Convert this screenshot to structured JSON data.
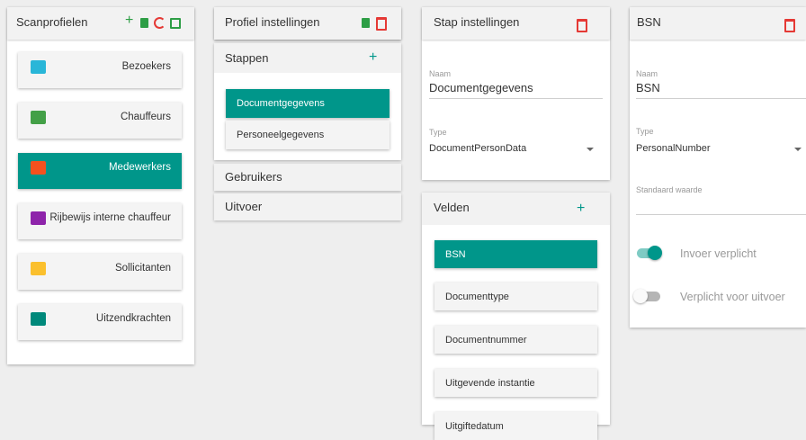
{
  "colors": {
    "accent": "#00968a",
    "green_icon": "#2e9e46",
    "red_icon": "#e53935"
  },
  "scanprofielen": {
    "title": "Scanprofielen",
    "actions": [
      "plus-icon",
      "file-icon",
      "refresh-icon",
      "save-icon"
    ],
    "items": [
      {
        "label": "Bezoekers",
        "icon": "walk-icon",
        "color": "#29b6d8"
      },
      {
        "label": "Chauffeurs",
        "icon": "truck-icon",
        "color": "#43a047"
      },
      {
        "label": "Medewerkers",
        "icon": "person-add-icon",
        "color": "#f4511e",
        "active": true
      },
      {
        "label": "Rijbewijs interne chauffeur",
        "icon": "bus-icon",
        "color": "#8e24aa"
      },
      {
        "label": "Sollicitanten",
        "icon": "people-icon",
        "color": "#fbc02d"
      },
      {
        "label": "Uitzendkrachten",
        "icon": "group-add-icon",
        "color": "#00897b"
      }
    ]
  },
  "profiel": {
    "title": "Profiel instellingen",
    "stappen": {
      "title": "Stappen",
      "items": [
        {
          "label": "Documentgegevens",
          "active": true
        },
        {
          "label": "Personeelgegevens"
        }
      ]
    },
    "gebruikers": "Gebruikers",
    "uitvoer": "Uitvoer"
  },
  "stap": {
    "title": "Stap instellingen",
    "naam_label": "Naam",
    "naam_value": "Documentgegevens",
    "type_label": "Type",
    "type_value": "DocumentPersonData"
  },
  "velden": {
    "title": "Velden",
    "items": [
      {
        "label": "BSN",
        "active": true
      },
      {
        "label": "Documenttype"
      },
      {
        "label": "Documentnummer"
      },
      {
        "label": "Uitgevende instantie"
      },
      {
        "label": "Uitgiftedatum"
      }
    ]
  },
  "bsn": {
    "title": "BSN",
    "naam_label": "Naam",
    "naam_value": "BSN",
    "type_label": "Type",
    "type_value": "PersonalNumber",
    "standaard_label": "Standaard waarde",
    "toggles": [
      {
        "label": "Invoer verplicht",
        "on": true
      },
      {
        "label": "Verplicht voor uitvoer",
        "on": false
      }
    ]
  }
}
